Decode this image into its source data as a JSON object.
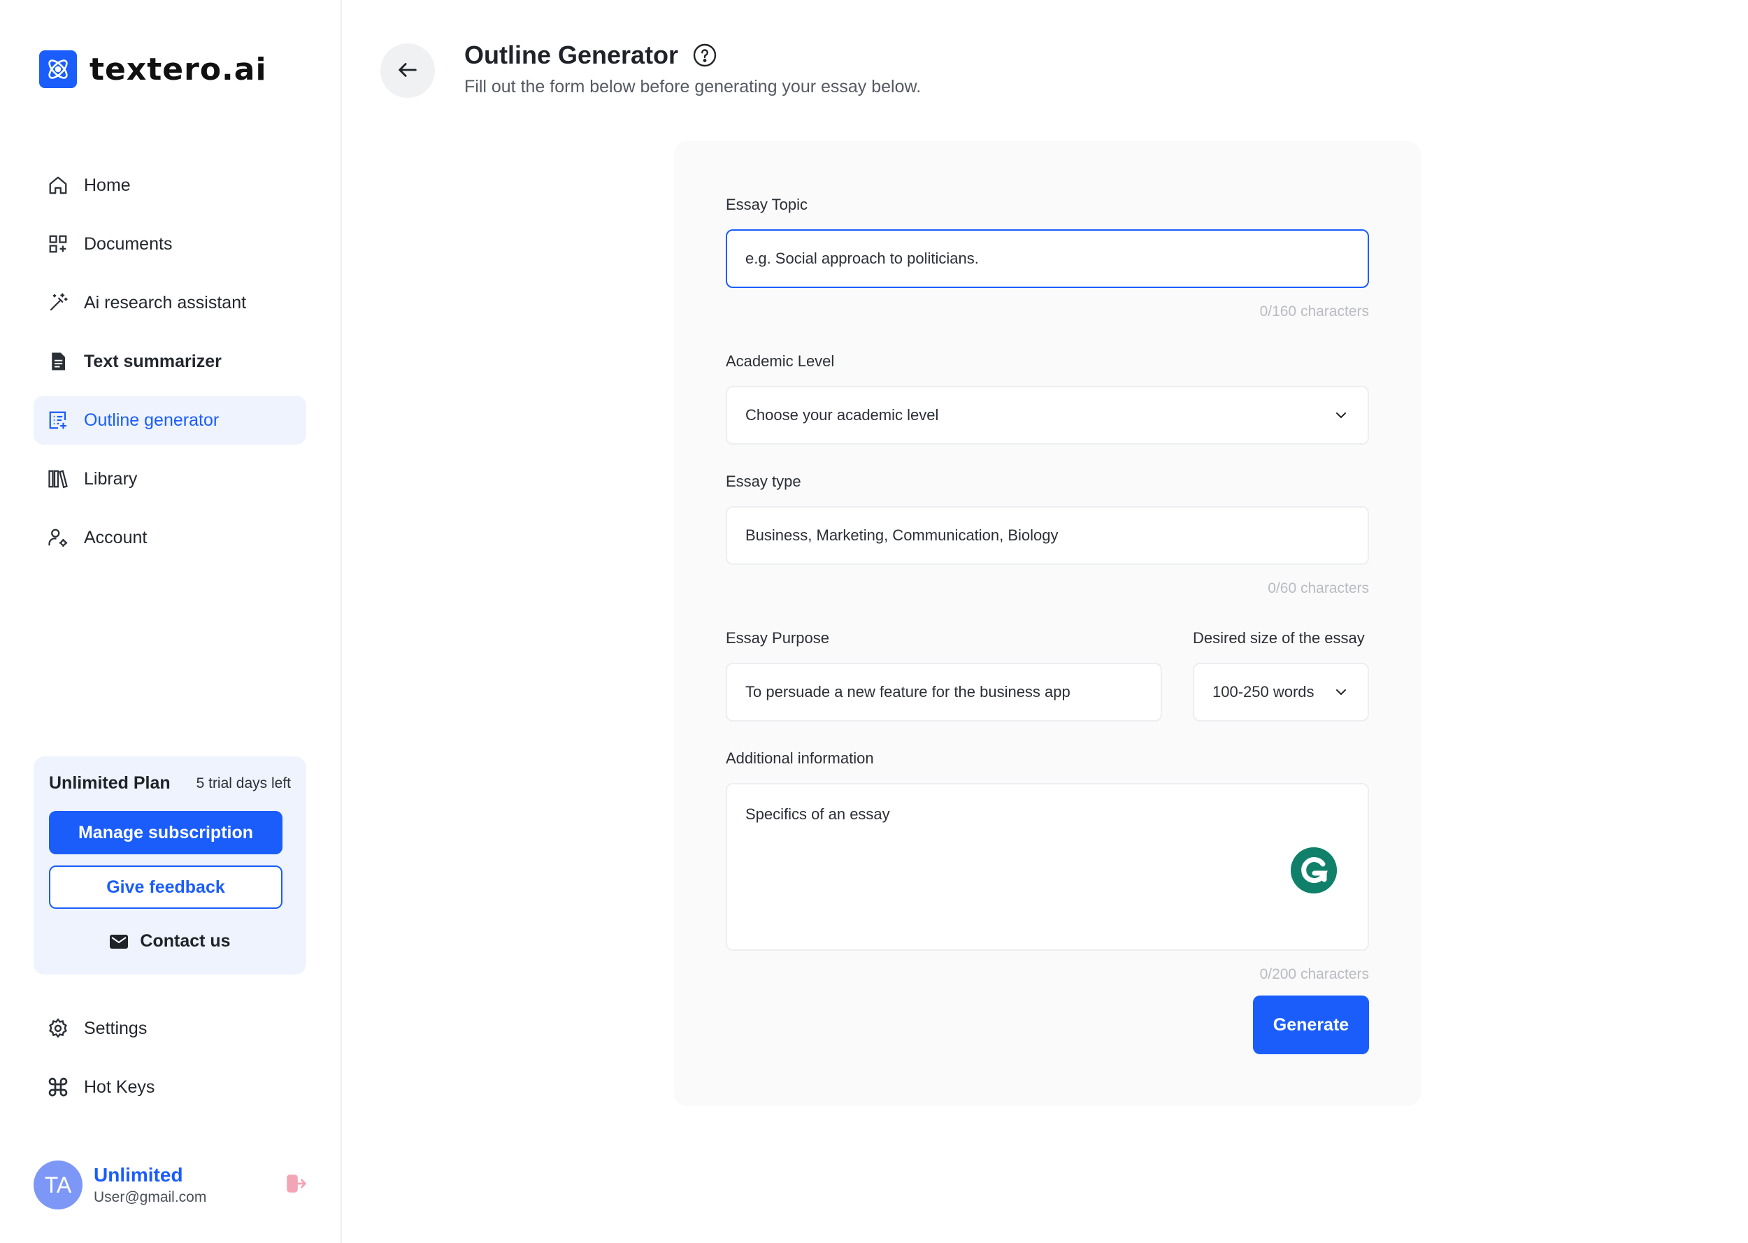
{
  "brand": {
    "name": "textero.ai"
  },
  "nav": {
    "items": [
      {
        "label": "Home",
        "icon": "home-icon"
      },
      {
        "label": "Documents",
        "icon": "grid-plus-icon"
      },
      {
        "label": "Ai research assistant",
        "icon": "magic-wand-icon"
      },
      {
        "label": "Text summarizer",
        "icon": "document-icon"
      },
      {
        "label": "Outline generator",
        "icon": "outline-icon",
        "active": true
      },
      {
        "label": "Library",
        "icon": "library-icon"
      },
      {
        "label": "Account",
        "icon": "user-gear-icon"
      }
    ],
    "bottom": [
      {
        "label": "Settings",
        "icon": "gear-icon"
      },
      {
        "label": "Hot Keys",
        "icon": "command-icon"
      }
    ]
  },
  "plan": {
    "name": "Unlimited Plan",
    "trial": "5 trial days left",
    "manage_label": "Manage subscription",
    "feedback_label": "Give feedback",
    "contact_label": "Contact us"
  },
  "user": {
    "initials": "TA",
    "plan": "Unlimited",
    "email": "User@gmail.com"
  },
  "header": {
    "title": "Outline Generator",
    "subtitle": "Fill out the form below before generating your essay below."
  },
  "form": {
    "topic": {
      "label": "Essay Topic",
      "placeholder": "e.g. Social approach to politicians.",
      "counter": "0/160 characters"
    },
    "level": {
      "label": "Academic Level",
      "placeholder": "Choose your academic level"
    },
    "type": {
      "label": "Essay type",
      "placeholder": "Business, Marketing, Communication, Biology",
      "counter": "0/60 characters"
    },
    "purpose": {
      "label": "Essay Purpose",
      "placeholder": "To persuade a new feature for the business app"
    },
    "size": {
      "label": "Desired size of the essay",
      "value": "100-250 words"
    },
    "additional": {
      "label": "Additional information",
      "placeholder": "Specifics of an essay",
      "counter": "0/200 characters"
    },
    "generate_label": "Generate"
  },
  "colors": {
    "accent": "#1a5dfb",
    "active_bg": "#eef3fd",
    "card_bg": "#fafafa"
  }
}
